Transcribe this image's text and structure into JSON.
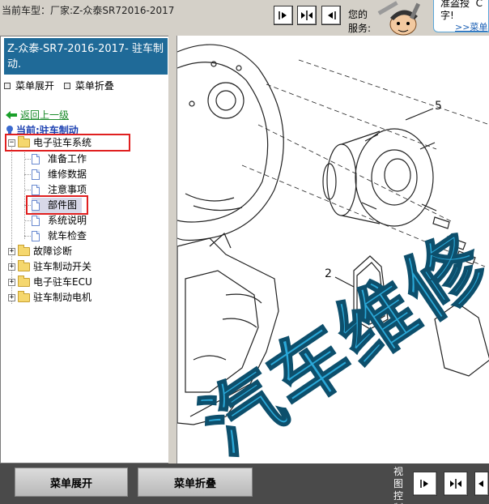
{
  "header": {
    "vehicle_label": "当前车型：厂家:Z-众泰SR72016-2017",
    "greeting": "您的\n服务:",
    "ad_text": "准盗授  C\n字!",
    "ad_more": ">>菜单"
  },
  "sidebar": {
    "title": "Z-众泰-SR7-2016-2017- 驻车制动.",
    "expand_all": "菜单展开",
    "collapse_all": "菜单折叠",
    "back": "返回上一级",
    "current": "当前:驻车制动",
    "tree": [
      {
        "label": "电子驻车系统",
        "type": "folder",
        "expanded": true,
        "highlighted": true
      },
      {
        "label": "准备工作",
        "type": "doc"
      },
      {
        "label": "维修数据",
        "type": "doc"
      },
      {
        "label": "注意事项",
        "type": "doc"
      },
      {
        "label": "部件图",
        "type": "doc",
        "selected": true,
        "highlighted": true
      },
      {
        "label": "系统说明",
        "type": "doc"
      },
      {
        "label": "就车检查",
        "type": "doc"
      },
      {
        "label": "故障诊断",
        "type": "folder"
      },
      {
        "label": "驻车制动开关",
        "type": "folder"
      },
      {
        "label": "电子驻车ECU",
        "type": "folder"
      },
      {
        "label": "驻车制动电机",
        "type": "folder"
      }
    ]
  },
  "diagram": {
    "callouts": [
      "5",
      "2"
    ],
    "watermark": "汽车维修"
  },
  "footer": {
    "expand_button": "菜单展开",
    "collapse_button": "菜单折叠",
    "view_control": "视图控制"
  },
  "colors": {
    "title_bar": "#1f6a98",
    "highlight_red": "#e02020",
    "watermark": "#2aa8d8"
  }
}
